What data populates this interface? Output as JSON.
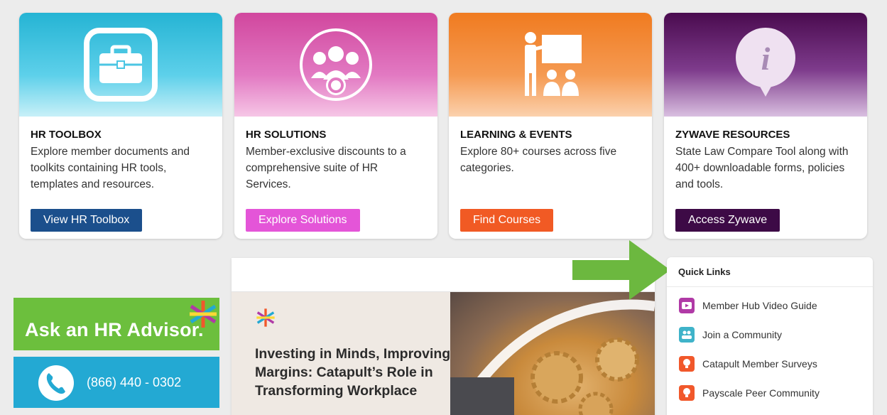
{
  "cards": [
    {
      "title": "HR TOOLBOX",
      "desc": "Explore member documents and toolkits containing HR tools, templates and resources.",
      "button": "View HR Toolbox",
      "btn_color": "#1b4f8c",
      "icon": "toolbox-icon"
    },
    {
      "title": "HR SOLUTIONS",
      "desc": "Member-exclusive discounts to a comprehensive suite of HR Services.",
      "button": "Explore Solutions",
      "btn_color": "#e455d8",
      "icon": "people-gear-icon"
    },
    {
      "title": "LEARNING & EVENTS",
      "desc": "Explore 80+ courses across five categories.",
      "button": "Find Courses",
      "btn_color": "#f15a24",
      "icon": "classroom-icon"
    },
    {
      "title": "ZYWAVE RESOURCES",
      "desc": "State Law Compare Tool along with 400+ downloadable forms, policies and tools.",
      "button": "Access Zywave",
      "btn_color": "#3d0a46",
      "icon": "info-pin-icon"
    }
  ],
  "banners": {
    "advisor": "Ask an HR Advisor.",
    "phone": "(866) 440 - 0302"
  },
  "feature": {
    "title": "Investing in Minds, Improving Margins: Catapult’s Role in Transforming Workplace"
  },
  "quick_links": {
    "heading": "Quick Links",
    "items": [
      {
        "label": "Member Hub Video Guide",
        "color": "#b03aa6",
        "icon": "video-icon"
      },
      {
        "label": "Join a Community",
        "color": "#3fb3c9",
        "icon": "community-icon"
      },
      {
        "label": "Catapult Member Surveys",
        "color": "#f1582b",
        "icon": "lightbulb-icon"
      },
      {
        "label": "Payscale Peer Community",
        "color": "#f1582b",
        "icon": "lightbulb-icon"
      }
    ]
  }
}
